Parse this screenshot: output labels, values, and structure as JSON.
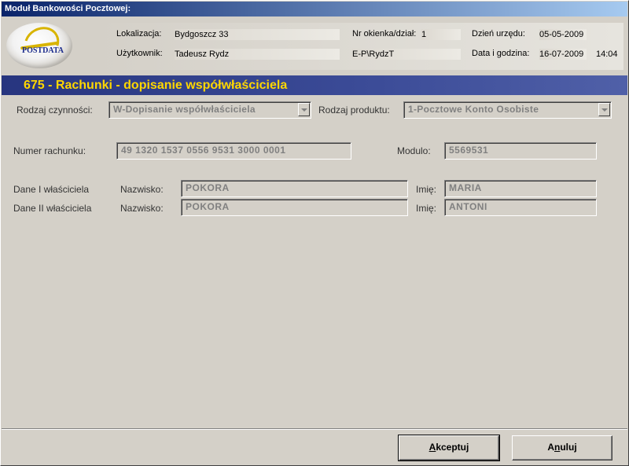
{
  "window": {
    "title": "Moduł Bankowości Pocztowej:"
  },
  "logo": {
    "text": "POSTDATA"
  },
  "info": {
    "location_label": "Lokalizacja:",
    "location_value": "Bydgoszcz 33",
    "window_label": "Nr okienka/dział:",
    "window_value": "1",
    "office_day_label": "Dzień urzędu:",
    "office_day_value": "05-05-2009",
    "user_label": "Użytkownik:",
    "user_value": "Tadeusz Rydz",
    "user_id_value": "E-P\\RydzT",
    "datetime_label": "Data i godzina:",
    "date_value": "16-07-2009",
    "time_value": "14:04"
  },
  "section": {
    "title": "675 - Rachunki - dopisanie współwłaściciela"
  },
  "form": {
    "operation_type_label": "Rodzaj czynności:",
    "operation_type_value": "W-Dopisanie współwłaściciela",
    "product_type_label": "Rodzaj produktu:",
    "product_type_value": "1-Pocztowe Konto Osobiste",
    "account_number_label": "Numer rachunku:",
    "account_number_value": "49 1320 1537 0556 9531 3000 0001",
    "modulo_label": "Modulo:",
    "modulo_value": "5569531",
    "owner1_label": "Dane I właściciela",
    "owner2_label": "Dane II właściciela",
    "surname_label": "Nazwisko:",
    "firstname_label": "Imię:",
    "owner1_surname": "POKORA",
    "owner1_firstname": "MARIA",
    "owner2_surname": "POKORA",
    "owner2_firstname": "ANTONI"
  },
  "buttons": {
    "accept_label": "Akceptuj",
    "cancel_label": "Anuluj"
  },
  "colors": {
    "title_accent": "#ffd700",
    "section_bar": "#2a3a8a",
    "titlebar_start": "#0a246a"
  }
}
